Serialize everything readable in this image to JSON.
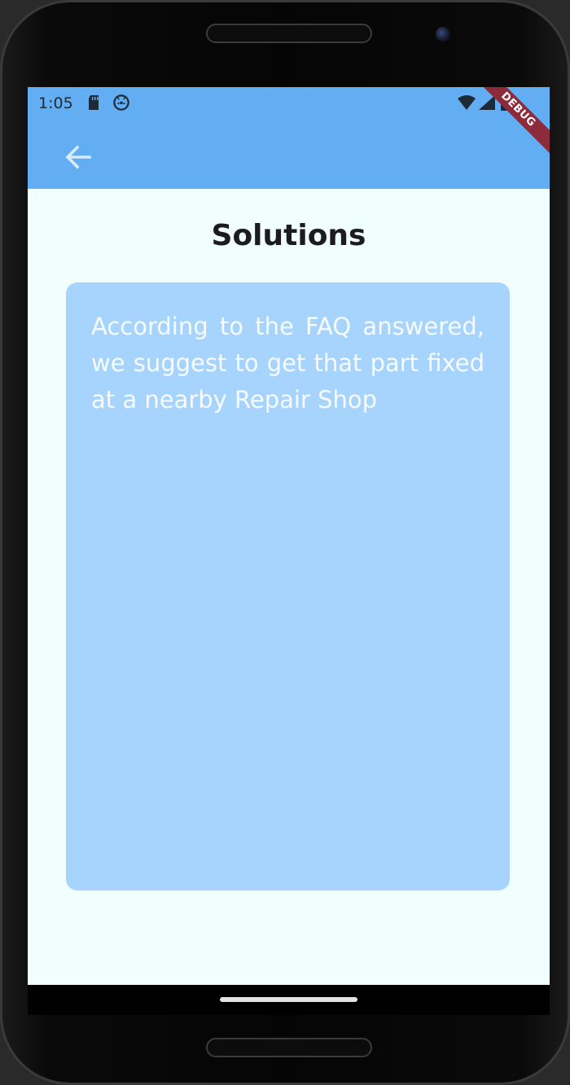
{
  "status_bar": {
    "time": "1:05",
    "icons": [
      "sd-card-icon",
      "android-debug-icon",
      "wifi-icon",
      "signal-icon",
      "battery-icon"
    ]
  },
  "debug_banner": {
    "label": "DEBUG"
  },
  "app_bar": {
    "back_icon": "arrow-back-icon"
  },
  "page": {
    "title": "Solutions",
    "solution_text": "According to the FAQ answered, we suggest to get that part fixed at a nearby Repair Shop"
  },
  "colors": {
    "app_bar": "#63adf2",
    "background": "#f1fefe",
    "card": "#a6d4fd",
    "card_text": "#f7fbff",
    "title_text": "#1c1c1c",
    "debug_banner": "#8e2b3b"
  }
}
